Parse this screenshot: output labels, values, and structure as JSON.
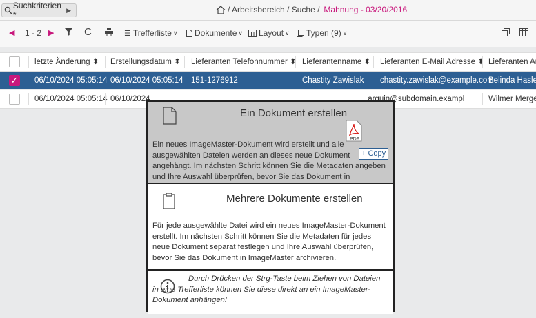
{
  "topbar": {
    "criteria_label": "Suchkriterien *",
    "breadcrumb_path": "/ Arbeitsbereich / Suche /",
    "breadcrumb_current": "Mahnung - 03/20/2016"
  },
  "toolbar": {
    "pagination": "1 - 2",
    "trefferliste": "Trefferliste",
    "dokumente": "Dokumente",
    "layout": "Layout",
    "typen": "Typen (9)"
  },
  "table": {
    "columns": [
      "letzte Änderung",
      "Erstellungsdatum",
      "Lieferanten Telefonnummer",
      "Lieferantenname",
      "Lieferanten E-Mail Adresse",
      "Lieferanten An"
    ],
    "rows": [
      {
        "checked": true,
        "cells": [
          "06/10/2024 05:05:14",
          "06/10/2024 05:05:14",
          "151-1276912",
          "Chastity Zawislak",
          "chastity.zawislak@example.com",
          "Belinda Hasley"
        ]
      },
      {
        "checked": false,
        "cells": [
          "06/10/2024 05:05:14",
          "06/10/2024",
          "",
          "",
          ".arguin@subdomain.exampl",
          "Wilmer Merge"
        ]
      }
    ]
  },
  "dropzone": {
    "single_title": "Ein Dokument erstellen",
    "single_text": "Ein neues ImageMaster-Dokument wird erstellt und alle ausgewählten Dateien werden an dieses neue Dokument angehängt. Im nächsten Schritt können Sie die Metadaten angeben und Ihre Auswahl überprüfen, bevor Sie das Dokument in ImageMaster archivieren.",
    "multi_title": "Mehrere Dokumente erstellen",
    "multi_text": "Für jede ausgewählte Datei wird ein neues ImageMaster-Dokument erstellt. Im nächsten Schritt können Sie die Metadaten für jedes neue Dokument separat festlegen und Ihre Auswahl überprüfen, bevor Sie das Dokument in ImageMaster archivieren.",
    "info_text": "Durch Drücken der Strg-Taste beim Ziehen von Dateien in eine Trefferliste können Sie diese direkt an ein ImageMaster-Dokument anhängen!"
  },
  "drag": {
    "badge": "PDF",
    "copy_label": "+ Copy"
  },
  "colors": {
    "accent": "#c8187c",
    "selected_row": "#2d5f93"
  }
}
